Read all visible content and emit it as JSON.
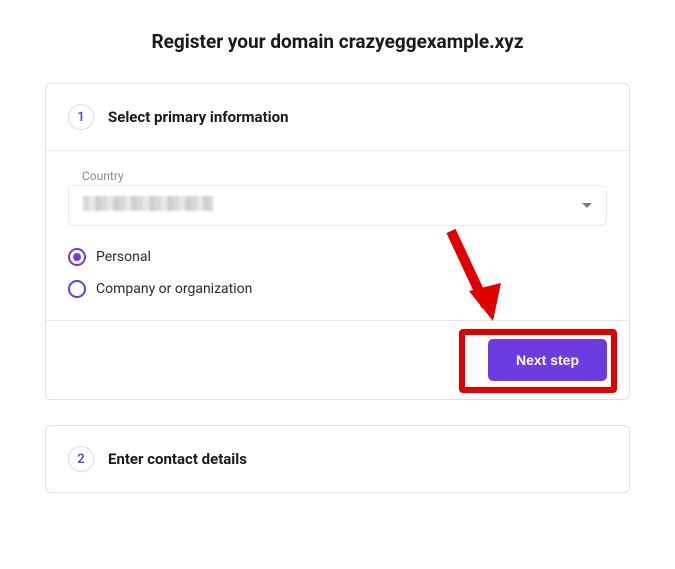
{
  "page": {
    "title": "Register your domain crazyeggexample.xyz"
  },
  "step1": {
    "number": "1",
    "title": "Select primary information",
    "country_label": "Country",
    "radio_personal": "Personal",
    "radio_company": "Company or organization",
    "next_button": "Next step"
  },
  "step2": {
    "number": "2",
    "title": "Enter contact details"
  },
  "colors": {
    "accent": "#6c3ce0",
    "highlight": "#e00000"
  }
}
